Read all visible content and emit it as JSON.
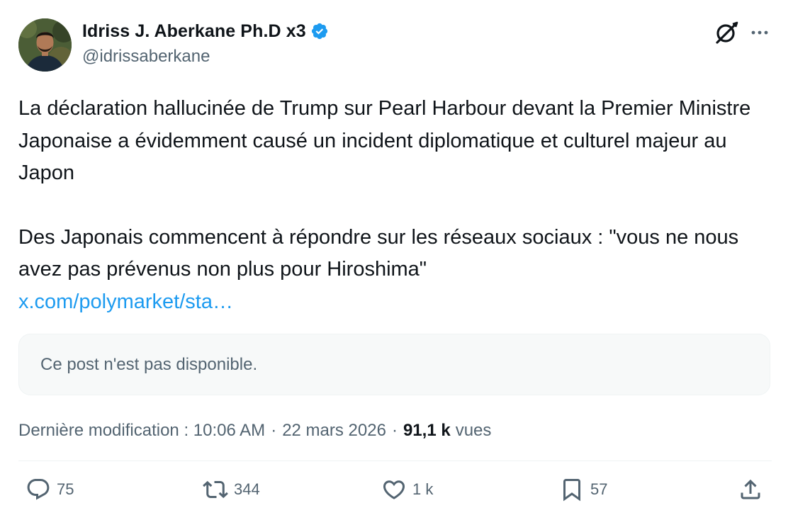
{
  "author": {
    "name": "Idriss J. Aberkane Ph.D x3",
    "handle": "@idrissaberkane",
    "verified_color": "#1d9bf0"
  },
  "header_icons": {
    "grok": "grok-icon",
    "more": "more-icon"
  },
  "post": {
    "paragraph_1": "La déclaration hallucinée de Trump sur Pearl Harbour devant la Premier Ministre Japonaise a évidemment causé un incident diplomatique et culturel majeur au Japon",
    "paragraph_2": "Des Japonais commencent à répondre sur les réseaux sociaux : \"vous ne nous avez pas prévenus non plus pour Hiroshima\"",
    "link": "x.com/polymarket/sta…"
  },
  "quote": {
    "unavailable_text": "Ce post n'est pas disponible."
  },
  "meta": {
    "edited_label": "Dernière modification : 10:06 AM",
    "separator": "·",
    "date": "22 mars 2026",
    "views_count": "91,1 k",
    "views_label": "vues"
  },
  "actions": {
    "replies": "75",
    "reposts": "344",
    "likes": "1 k",
    "bookmarks": "57"
  },
  "colors": {
    "text": "#0f1419",
    "secondary": "#536471",
    "link": "#1d9bf0",
    "quote_bg": "#f7f9f9",
    "border": "#eff3f4"
  }
}
